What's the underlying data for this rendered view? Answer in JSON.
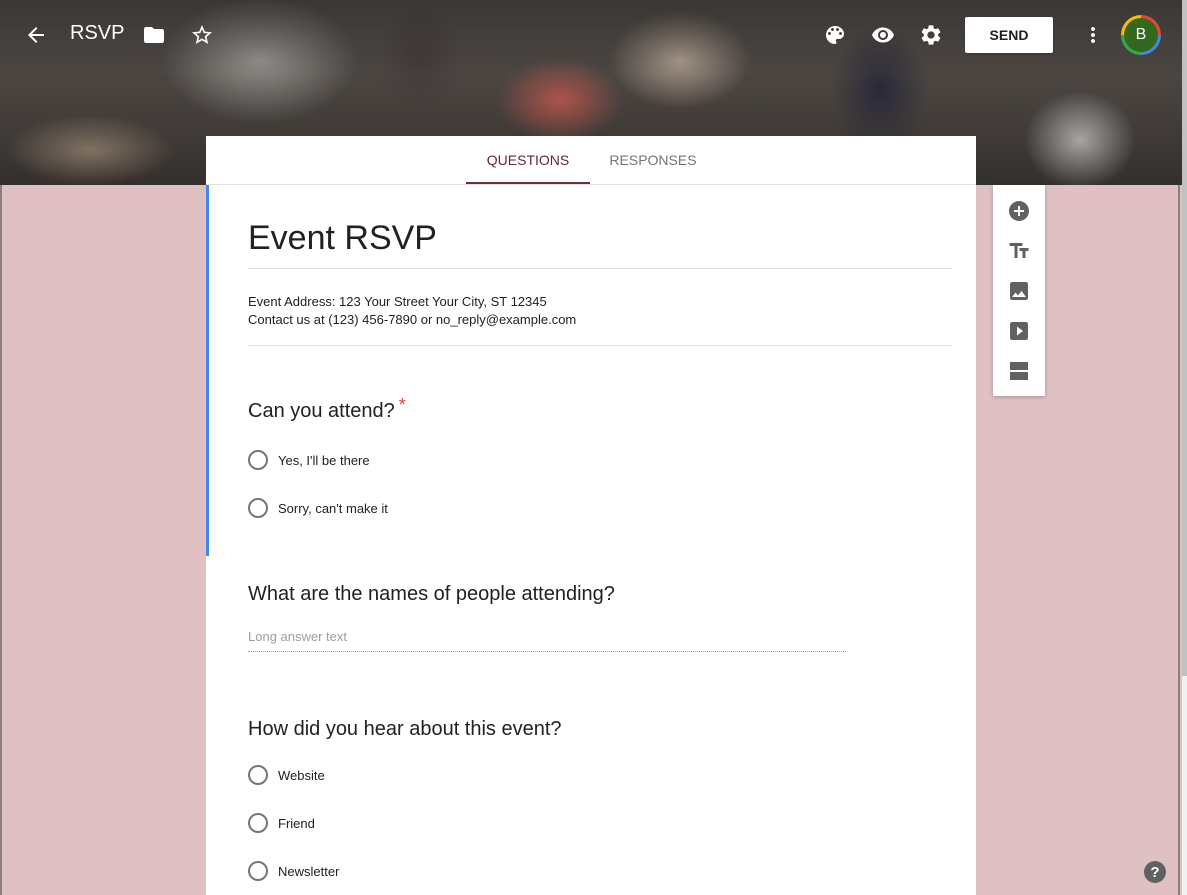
{
  "toolbar": {
    "doc_title": "RSVP",
    "send_label": "SEND",
    "avatar_initial": "B",
    "icons": [
      "back-arrow-icon",
      "folder-icon",
      "star-icon",
      "palette-icon",
      "eye-icon",
      "gear-icon",
      "more-vert-icon"
    ]
  },
  "tabs": [
    {
      "label": "Questions",
      "active": true
    },
    {
      "label": "Responses",
      "active": false
    }
  ],
  "form": {
    "title": "Event RSVP",
    "description_line1": "Event Address: 123 Your Street Your City, ST 12345",
    "description_line2": "Contact us at (123) 456-7890 or no_reply@example.com",
    "questions": [
      {
        "title": "Can you attend?",
        "required_mark": "*",
        "options": [
          "Yes,  I'll be there",
          "Sorry, can't make it"
        ]
      },
      {
        "title": "What are the names of people attending?",
        "placeholder": "Long answer text"
      },
      {
        "title": "How did you hear about this event?",
        "options": [
          "Website",
          "Friend",
          "Newsletter"
        ]
      }
    ]
  },
  "toolbox": {
    "icons": [
      "add-question-icon",
      "title-text-icon",
      "image-icon",
      "video-icon",
      "section-icon"
    ]
  },
  "help": {
    "label": "?"
  },
  "colors": {
    "page_background": "#e0c1c3",
    "accent": "#6d2f32",
    "focus_bar": "#4285f4",
    "required": "#db4437"
  }
}
